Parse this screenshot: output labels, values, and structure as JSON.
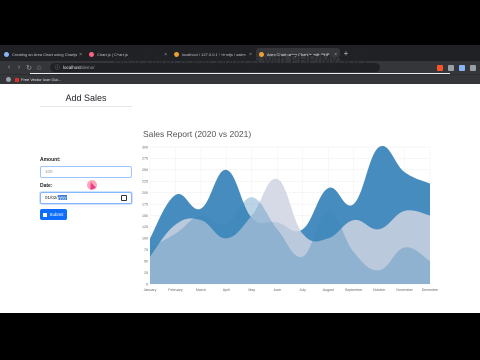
{
  "browser": {
    "tabs": [
      {
        "title": "Creating an Area Chart using Chartjs",
        "active": false
      },
      {
        "title": "Chart.js | Chart.js",
        "active": false
      },
      {
        "title": "localhost / 127.0.0.1 / chartjs / sales",
        "active": false
      },
      {
        "title": "Area Chart using Chart.js with PHP",
        "active": true
      }
    ],
    "address": {
      "host": "localhost",
      "path": "/demo/"
    },
    "bookmark": "Free Vector Icon Gui..."
  },
  "page": {
    "title": "Area Chart using Chart.js with PHP/MySQLi"
  },
  "form": {
    "title": "Add Sales",
    "amount_label": "Amount:",
    "amount_placeholder": "100",
    "date_label": "Date:",
    "date_value_prefix": "01/02/",
    "date_value_selected": "yyyy",
    "submit_label": "Submit"
  },
  "chart_data": {
    "type": "area",
    "title": "Sales Report (2020 vs 2021)",
    "categories": [
      "January",
      "February",
      "March",
      "April",
      "May",
      "June",
      "July",
      "August",
      "September",
      "October",
      "November",
      "December"
    ],
    "ylim": [
      0,
      300
    ],
    "yticks": [
      0,
      25,
      50,
      75,
      100,
      125,
      150,
      175,
      200,
      225,
      250,
      275,
      300
    ],
    "series": [
      {
        "values": [
          100,
          195,
          165,
          250,
          145,
          135,
          120,
          210,
          175,
          300,
          245,
          220
        ],
        "color": "#3d86bb"
      },
      {
        "values": [
          60,
          130,
          140,
          100,
          150,
          230,
          110,
          100,
          140,
          120,
          160,
          150
        ],
        "color": "#cfd4e2"
      },
      {
        "values": [
          80,
          110,
          150,
          130,
          190,
          120,
          60,
          160,
          70,
          30,
          80,
          50
        ],
        "color": "#3d86bb"
      }
    ]
  }
}
